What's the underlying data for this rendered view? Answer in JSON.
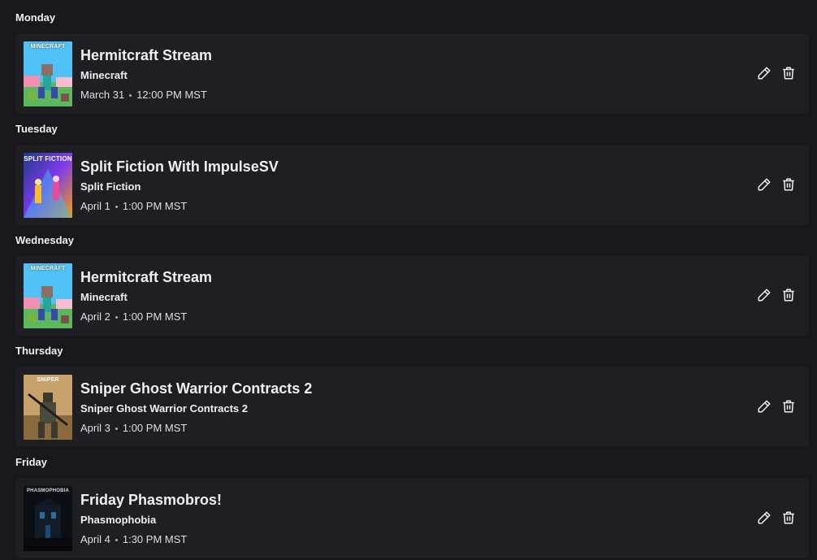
{
  "schedule": [
    {
      "day": "Monday",
      "title": "Hermitcraft Stream",
      "game": "Minecraft",
      "date": "March 31",
      "time": "12:00 PM MST",
      "thumbnail_art": "MINECRAFT"
    },
    {
      "day": "Tuesday",
      "title": "Split Fiction With ImpulseSV",
      "game": "Split Fiction",
      "date": "April 1",
      "time": "1:00 PM MST",
      "thumbnail_art": "SPLIT FICTION"
    },
    {
      "day": "Wednesday",
      "title": "Hermitcraft Stream",
      "game": "Minecraft",
      "date": "April 2",
      "time": "1:00 PM MST",
      "thumbnail_art": "MINECRAFT"
    },
    {
      "day": "Thursday",
      "title": "Sniper Ghost Warrior Contracts 2",
      "game": "Sniper Ghost Warrior Contracts 2",
      "date": "April 3",
      "time": "1:00 PM MST",
      "thumbnail_art": "SNIPER"
    },
    {
      "day": "Friday",
      "title": "Friday Phasmobros!",
      "game": "Phasmophobia",
      "date": "April 4",
      "time": "1:30 PM MST",
      "thumbnail_art": "PHASMOPHOBIA"
    }
  ],
  "icons": {
    "edit": "pencil-icon",
    "delete": "trash-icon"
  },
  "colors": {
    "background": "#18181b",
    "card": "#1f1f23",
    "text": "#efeff1"
  }
}
